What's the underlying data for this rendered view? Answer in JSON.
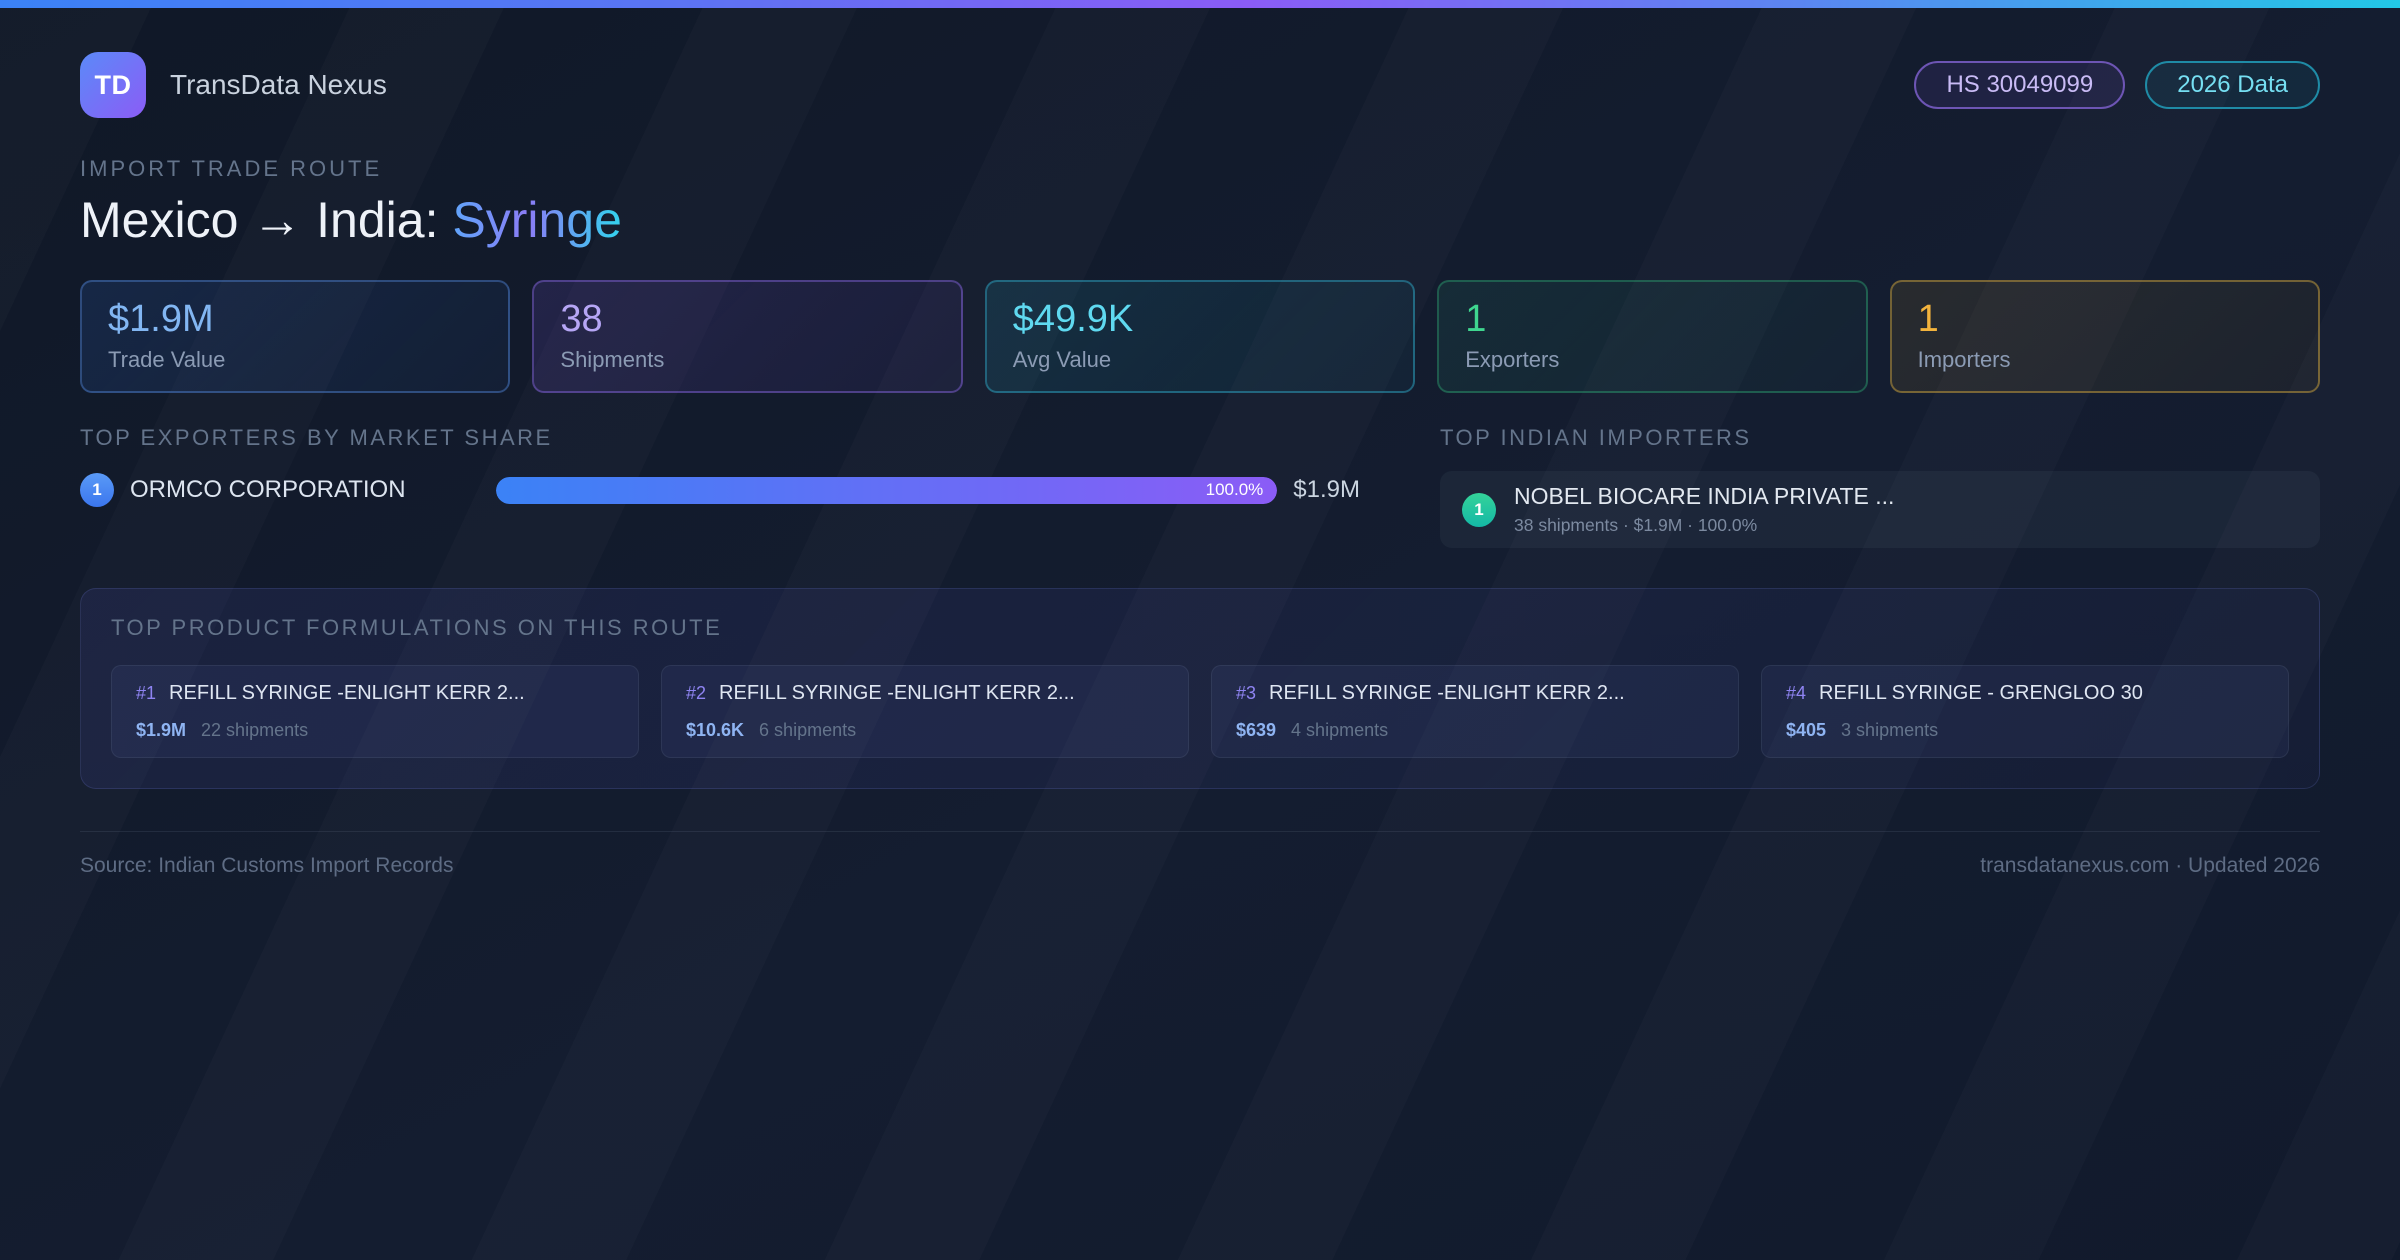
{
  "app": {
    "logo_text": "TD",
    "title": "TransData Nexus",
    "hs_badge": "HS 30049099",
    "year_badge": "2026 Data"
  },
  "route": {
    "eyebrow": "IMPORT TRADE ROUTE",
    "title_main": "Mexico → India:",
    "title_product": "Syringe"
  },
  "stats": [
    {
      "value": "$1.9M",
      "label": "Trade Value",
      "accent": "#82b6f2"
    },
    {
      "value": "38",
      "label": "Shipments",
      "accent": "#b6a6f5"
    },
    {
      "value": "$49.9K",
      "label": "Avg Value",
      "accent": "#5fd9f0"
    },
    {
      "value": "1",
      "label": "Exporters",
      "accent": "#3fd68f"
    },
    {
      "value": "1",
      "label": "Importers",
      "accent": "#f2b33d"
    }
  ],
  "exporters": {
    "heading": "TOP EXPORTERS BY MARKET SHARE",
    "items": [
      {
        "rank": "1",
        "name": "ORMCO CORPORATION",
        "share_pct": 100,
        "share_label": "100.0%",
        "value": "$1.9M"
      }
    ]
  },
  "importers": {
    "heading": "TOP INDIAN IMPORTERS",
    "items": [
      {
        "rank": "1",
        "name": "NOBEL BIOCARE INDIA PRIVATE ...",
        "details": "38 shipments · $1.9M · 100.0%"
      }
    ]
  },
  "formulations": {
    "heading": "TOP PRODUCT FORMULATIONS ON THIS ROUTE",
    "items": [
      {
        "rank": "#1",
        "name": "REFILL SYRINGE -ENLIGHT KERR 2...",
        "value": "$1.9M",
        "shipments": "22 shipments"
      },
      {
        "rank": "#2",
        "name": "REFILL SYRINGE -ENLIGHT KERR 2...",
        "value": "$10.6K",
        "shipments": "6 shipments"
      },
      {
        "rank": "#3",
        "name": "REFILL SYRINGE -ENLIGHT KERR 2...",
        "value": "$639",
        "shipments": "4 shipments"
      },
      {
        "rank": "#4",
        "name": "REFILL SYRINGE - GRENGLOO 30",
        "value": "$405",
        "shipments": "3 shipments"
      }
    ]
  },
  "footer": {
    "source": "Source: Indian Customs Import Records",
    "site": "transdatanexus.com · Updated 2026"
  },
  "colors": {
    "background": "#121a2b",
    "accent_blue": "#3b82f6",
    "accent_purple": "#8b5cf6",
    "accent_cyan": "#22d3ee",
    "accent_green": "#34d399",
    "accent_amber": "#fbbf24",
    "top_bar_gradient": [
      "#3b82f6",
      "#8b5cf6",
      "#5b86f2",
      "#22c8e6"
    ],
    "bar_gradient": [
      "#3b82f6",
      "#8b5cf6"
    ]
  }
}
